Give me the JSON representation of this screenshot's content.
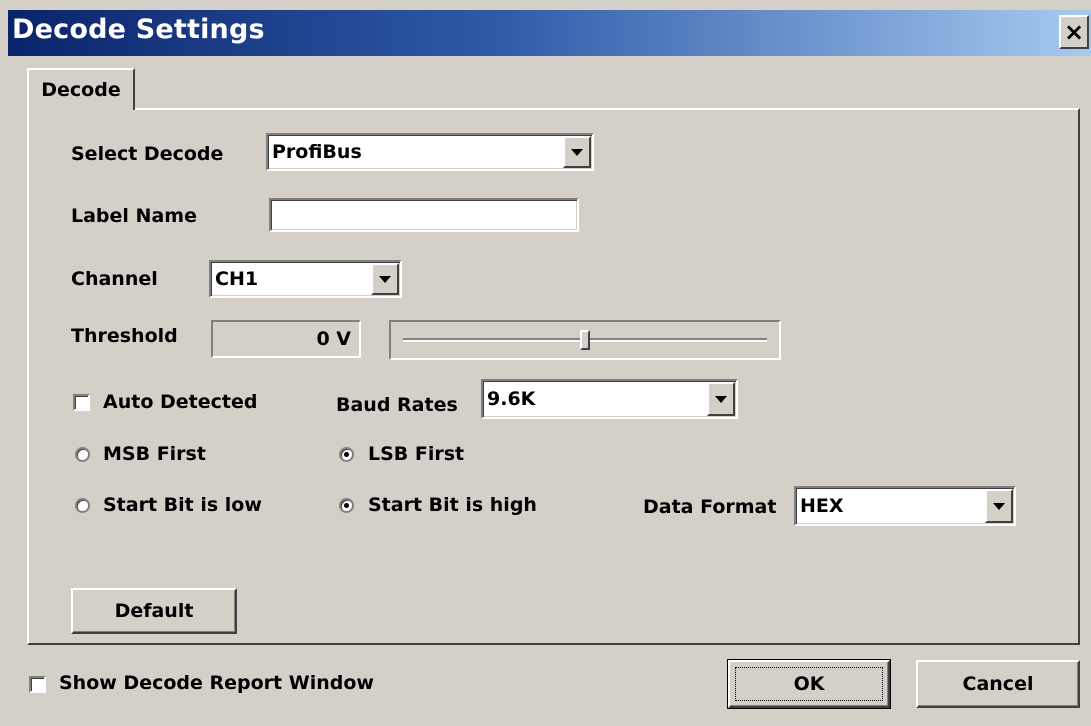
{
  "window": {
    "title": "Decode Settings",
    "close_label": "×"
  },
  "tabs": [
    {
      "label": "Decode"
    }
  ],
  "form": {
    "select_decode": {
      "label": "Select Decode",
      "value": "ProfiBus"
    },
    "label_name": {
      "label": "Label Name",
      "value": ""
    },
    "channel": {
      "label": "Channel",
      "value": "CH1"
    },
    "threshold": {
      "label": "Threshold",
      "value": "0 V",
      "slider_level": 0.5
    },
    "auto_detected": {
      "label": "Auto Detected",
      "checked": false
    },
    "baud_rates": {
      "label": "Baud Rates",
      "value": "9.6K"
    },
    "bit_order": {
      "msb_label": "MSB First",
      "lsb_label": "LSB First",
      "selected": "LSB First"
    },
    "start_bit": {
      "low_label": "Start Bit is low",
      "high_label": "Start Bit is high",
      "selected": "Start Bit is high"
    },
    "data_format": {
      "label": "Data Format",
      "value": "HEX"
    },
    "default_button": "Default"
  },
  "footer": {
    "show_report": {
      "label": "Show Decode Report Window",
      "checked": false
    },
    "ok_button": "OK",
    "cancel_button": "Cancel"
  }
}
